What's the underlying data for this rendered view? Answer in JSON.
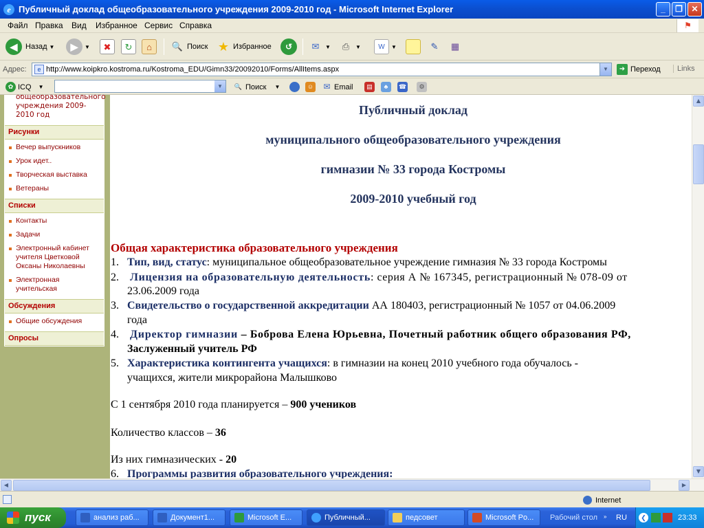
{
  "window": {
    "title": "Публичный доклад общеобразовательного учреждения 2009-2010 год - Microsoft Internet Explorer"
  },
  "menu": [
    "Файл",
    "Правка",
    "Вид",
    "Избранное",
    "Сервис",
    "Справка"
  ],
  "toolbar": {
    "back": "Назад",
    "search": "Поиск",
    "favorites": "Избранное"
  },
  "address": {
    "label": "Адрес:",
    "url": "http://www.koipkro.kostroma.ru/Kostroma_EDU/Gimn33/20092010/Forms/AllItems.aspx",
    "go": "Переход",
    "links": "Links"
  },
  "icqbar": {
    "icq": "ICQ",
    "search": "Поиск",
    "email": "Email"
  },
  "sidebar": {
    "top_item": "общеобразовательного учреждения 2009-2010 год",
    "sections": [
      {
        "title": "Рисунки",
        "items": [
          "Вечер выпускников",
          "Урок идет..",
          "Творческая выставка",
          "Ветераны"
        ]
      },
      {
        "title": "Списки",
        "items": [
          "Контакты",
          "Задачи",
          "Электронный кабинет учителя Цветковой Оксаны Николаевны",
          "Электронная учительская"
        ]
      },
      {
        "title": "Обсуждения",
        "items": [
          "Общие обсуждения"
        ]
      },
      {
        "title": "Опросы",
        "items": []
      }
    ]
  },
  "doc": {
    "heading": [
      "Публичный доклад",
      "муниципального общеобразовательного учреждения",
      "гимназии № 33 города Костромы",
      "2009-2010 учебный год"
    ],
    "section_title": "Общая характеристика образовательного учреждения",
    "items": [
      {
        "num": "1.",
        "label": "Тип, вид, статус",
        "text": ": муниципальное общеобразовательное учреждение гимназия № 33 города Костромы"
      },
      {
        "num": "2.",
        "label": "Лицензия на образовательную деятельность",
        "text": ": серия А № 167345, регистрационный № 078-09 от",
        "cont": "23.06.2009 года"
      },
      {
        "num": "3.",
        "label": "Свидетельство о государственной аккредитации",
        "text": " АА 180403, регистрационный № 1057 от 04.06.2009",
        "cont": "года"
      },
      {
        "num": "4.",
        "label": "Директор гимназии",
        "text": " – Боброва Елена Юрьевна, Почетный работник общего образования РФ,",
        "cont": "Заслуженный учитель РФ"
      },
      {
        "num": "5.",
        "label": "Характеристика контингента учащихся",
        "text": ": в гимназии на конец 2010 учебного года обучалось  -",
        "cont": "учащихся, жители микрорайона Малышково"
      }
    ],
    "plan_text": "С 1 сентября 2010 года планируется – ",
    "plan_value": "900 учеников",
    "classes_text": "Количество классов – ",
    "classes_value": "36",
    "gym_text": "Из них гимназических - ",
    "gym_value": "20",
    "item6": {
      "num": "6.",
      "label": "Программы развития образовательного учреждения:"
    }
  },
  "status": {
    "zone": "Internet"
  },
  "taskbar": {
    "start": "пуск",
    "tasks": [
      "анализ раб...",
      "Документ1...",
      "Microsoft E...",
      "Публичный...",
      "педсовет",
      "Microsoft Po..."
    ],
    "desktop": "Рабочий стол",
    "lang": "RU",
    "clock": "23:33"
  },
  "colors": {
    "sidebar_bg": "#adb47a",
    "heading": "#24345e",
    "section_red": "#b30000"
  }
}
